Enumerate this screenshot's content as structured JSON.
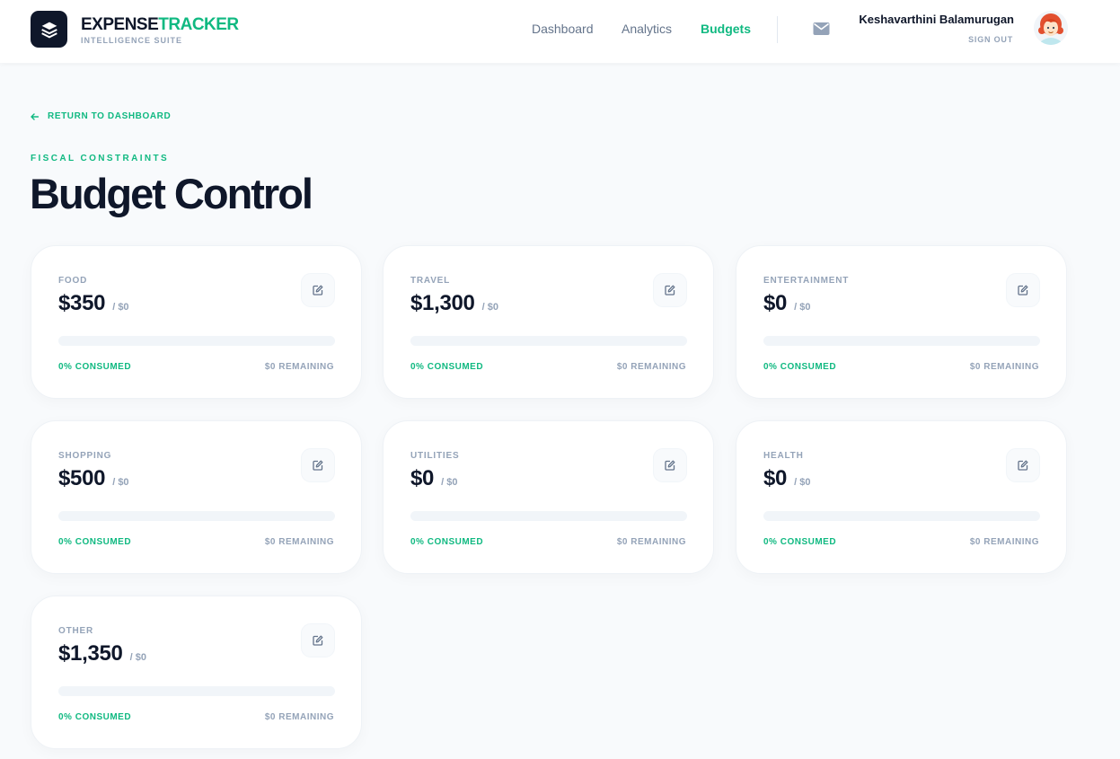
{
  "brand": {
    "name_part1": "EXPENSE",
    "name_part2": "TRACKER",
    "subtitle": "INTELLIGENCE SUITE",
    "logo_icon": "layers-icon"
  },
  "nav": {
    "items": [
      {
        "label": "Dashboard",
        "active": false
      },
      {
        "label": "Analytics",
        "active": false
      },
      {
        "label": "Budgets",
        "active": true
      }
    ],
    "mail_icon": "mail-icon"
  },
  "user": {
    "name": "Keshavarthini Balamurugan",
    "sign_out": "SIGN OUT",
    "avatar_icon": "user-avatar"
  },
  "page": {
    "back_link": "RETURN TO DASHBOARD",
    "back_icon": "arrow-left-icon",
    "eyebrow": "FISCAL CONSTRAINTS",
    "title": "Budget Control"
  },
  "budgets": [
    {
      "category": "FOOD",
      "amount": "$350",
      "limit": "/ $0",
      "consumed": "0% CONSUMED",
      "remaining": "$0 REMAINING",
      "progress": 0
    },
    {
      "category": "TRAVEL",
      "amount": "$1,300",
      "limit": "/ $0",
      "consumed": "0% CONSUMED",
      "remaining": "$0 REMAINING",
      "progress": 0
    },
    {
      "category": "ENTERTAINMENT",
      "amount": "$0",
      "limit": "/ $0",
      "consumed": "0% CONSUMED",
      "remaining": "$0 REMAINING",
      "progress": 0
    },
    {
      "category": "SHOPPING",
      "amount": "$500",
      "limit": "/ $0",
      "consumed": "0% CONSUMED",
      "remaining": "$0 REMAINING",
      "progress": 0
    },
    {
      "category": "UTILITIES",
      "amount": "$0",
      "limit": "/ $0",
      "consumed": "0% CONSUMED",
      "remaining": "$0 REMAINING",
      "progress": 0
    },
    {
      "category": "HEALTH",
      "amount": "$0",
      "limit": "/ $0",
      "consumed": "0% CONSUMED",
      "remaining": "$0 REMAINING",
      "progress": 0
    },
    {
      "category": "OTHER",
      "amount": "$1,350",
      "limit": "/ $0",
      "consumed": "0% CONSUMED",
      "remaining": "$0 REMAINING",
      "progress": 0
    }
  ],
  "colors": {
    "accent": "#10b981",
    "ink": "#0f172a",
    "muted": "#94a3b8",
    "track": "#f1f5f9"
  }
}
